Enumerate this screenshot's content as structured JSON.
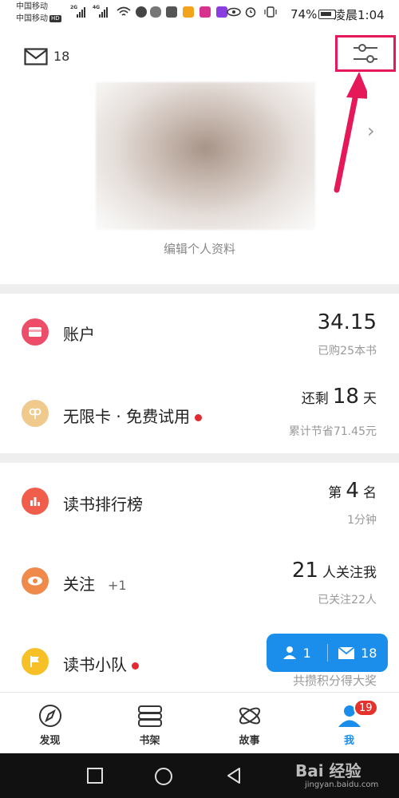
{
  "status_bar": {
    "carrier1": "中国移动",
    "carrier2": "中国移动",
    "hd": "HD",
    "net1": "2G",
    "net2": "4G",
    "battery_percent": "74%",
    "time": "凌晨1:04"
  },
  "header": {
    "mail_count": "18",
    "edit_profile": "编辑个人资料"
  },
  "account_section": {
    "rows": [
      {
        "label": "账户",
        "main_value": "34.15",
        "sub": "已购25本书",
        "icon_color": "#ee4d6a"
      },
      {
        "label": "无限卡 · 免费试用",
        "prefix": "还剩",
        "main_value": "18",
        "suffix": "天",
        "sub": "累计节省71.45元",
        "icon_color": "#f0c98d"
      }
    ]
  },
  "social_section": {
    "rows": [
      {
        "label": "读书排行榜",
        "prefix": "第",
        "main_value": "4",
        "suffix": "名",
        "sub": "1分钟",
        "icon_color": "#f05d4a"
      },
      {
        "label": "关注",
        "extra": "+1",
        "main_value": "21",
        "suffix": "人关注我",
        "sub": "已关注22人",
        "icon_color": "#f08a4b"
      },
      {
        "label": "读书小队",
        "sub": "共攒积分得大奖",
        "icon_color": "#f6c026"
      }
    ]
  },
  "floating": {
    "followers": "1",
    "mail": "18"
  },
  "bottom_nav": {
    "items": [
      {
        "label": "发现"
      },
      {
        "label": "书架"
      },
      {
        "label": "故事"
      },
      {
        "label": "我",
        "badge": "19"
      }
    ],
    "active_color": "#1a8eea"
  },
  "watermark": {
    "main": "Bai 经验",
    "sub": "jingyan.baidu.com"
  }
}
